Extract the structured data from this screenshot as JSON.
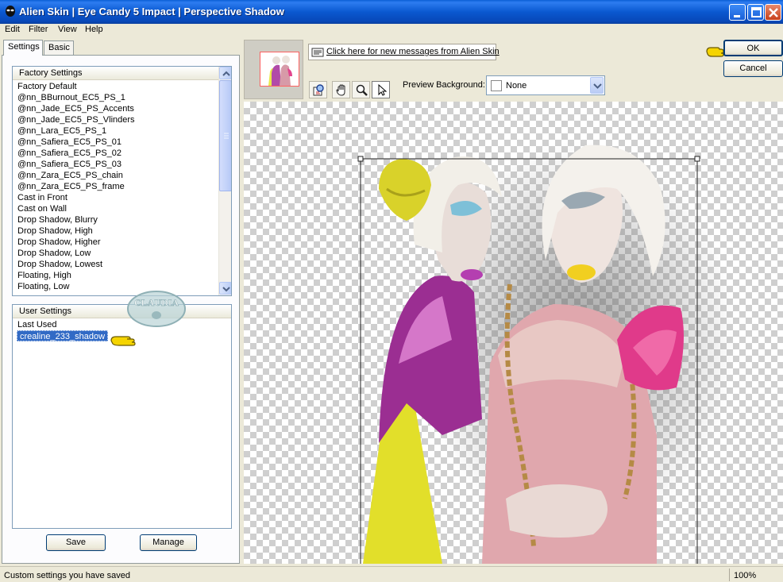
{
  "window": {
    "title": "Alien Skin  |  Eye Candy 5 Impact  |  Perspective Shadow",
    "title_bar_color": "#0a58d0"
  },
  "menu": [
    "Edit",
    "Filter",
    "View",
    "Help"
  ],
  "tabs": [
    {
      "label": "Settings",
      "active": true
    },
    {
      "label": "Basic",
      "active": false
    }
  ],
  "factory_settings": {
    "header": "Factory Settings",
    "items": [
      "Factory Default",
      "@nn_BBurnout_EC5_PS_1",
      "@nn_Jade_EC5_PS_Accents",
      "@nn_Jade_EC5_PS_Vlinders",
      "@nn_Lara_EC5_PS_1",
      "@nn_Safiera_EC5_PS_01",
      "@nn_Safiera_EC5_PS_02",
      "@nn_Safiera_EC5_PS_03",
      "@nn_Zara_EC5_PS_chain",
      "@nn_Zara_EC5_PS_frame",
      "Cast in Front",
      "Cast on Wall",
      "Drop Shadow, Blurry",
      "Drop Shadow, High",
      "Drop Shadow, Higher",
      "Drop Shadow, Low",
      "Drop Shadow, Lowest",
      "Floating, High",
      "Floating, Low"
    ]
  },
  "user_settings": {
    "header": "User Settings",
    "items": [
      "Last Used",
      "crealine_233_shadow"
    ],
    "selected": "crealine_233_shadow"
  },
  "watermark": "CLAUDIA",
  "buttons": {
    "save": "Save",
    "manage": "Manage",
    "ok": "OK",
    "cancel": "Cancel"
  },
  "message_link": "Click here for new messages from Alien Skin",
  "tools": [
    "navigator-icon",
    "hand-icon",
    "zoom-icon",
    "pointer-icon"
  ],
  "preview_background": {
    "label": "Preview Background:",
    "value": "None"
  },
  "status": {
    "text": "Custom settings you have saved",
    "zoom": "100%"
  },
  "colors": {
    "selection": "#316ac5",
    "accent_pointer": "#f5d400"
  }
}
